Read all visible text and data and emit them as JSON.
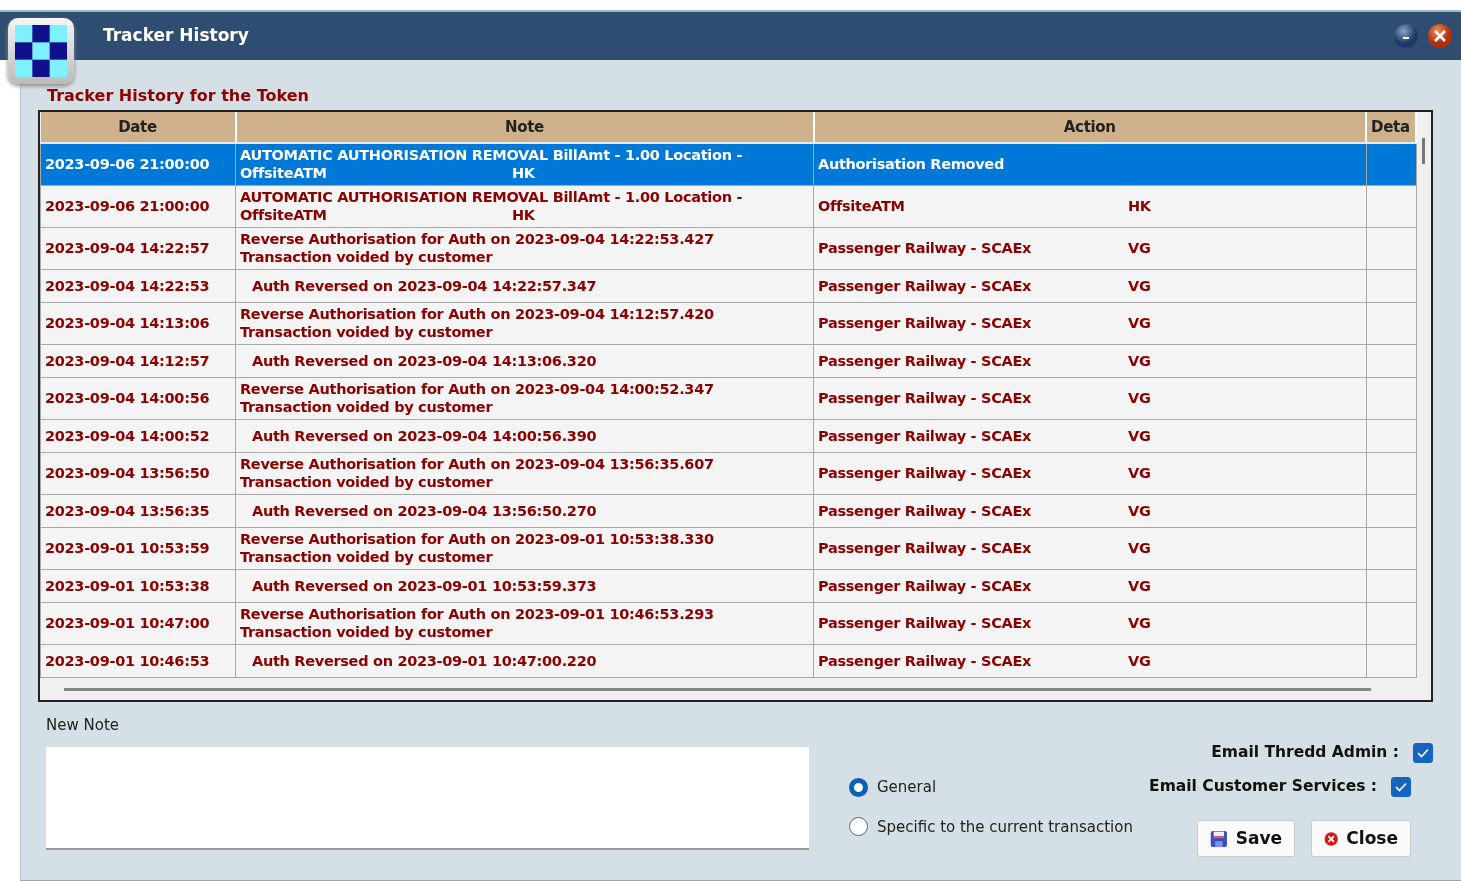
{
  "window": {
    "title": "Tracker History"
  },
  "group_title": "Tracker History for the Token",
  "table": {
    "columns": [
      "Date",
      "Note",
      "Action",
      "Deta"
    ],
    "rows": [
      {
        "date": "2023-09-06 21:00:00",
        "note": [
          [
            "AUTOMATIC AUTHORISATION REMOVAL BillAmt - 1.00 Location -"
          ],
          [
            "OffsiteATM",
            "HK"
          ]
        ],
        "action": [
          "Authorisation Removed"
        ],
        "selected": true
      },
      {
        "date": "2023-09-06 21:00:00",
        "note": [
          [
            "AUTOMATIC AUTHORISATION REMOVAL BillAmt - 1.00 Location -"
          ],
          [
            "OffsiteATM",
            "HK"
          ]
        ],
        "action": [
          "OffsiteATM",
          "HK"
        ],
        "selected": false
      },
      {
        "date": "2023-09-04 14:22:57",
        "note": [
          [
            "Reverse Authorisation for Auth on 2023-09-04 14:22:53.427"
          ],
          [
            "Transaction voided by customer"
          ]
        ],
        "action": [
          "Passenger Railway - SCAEx",
          "VG"
        ],
        "selected": false
      },
      {
        "date": "2023-09-04 14:22:53",
        "note": [
          [
            "Auth Reversed on 2023-09-04 14:22:57.347"
          ]
        ],
        "action": [
          "Passenger Railway - SCAEx",
          "VG"
        ],
        "selected": false
      },
      {
        "date": "2023-09-04 14:13:06",
        "note": [
          [
            "Reverse Authorisation for Auth on 2023-09-04 14:12:57.420"
          ],
          [
            "Transaction voided by customer"
          ]
        ],
        "action": [
          "Passenger Railway - SCAEx",
          "VG"
        ],
        "selected": false
      },
      {
        "date": "2023-09-04 14:12:57",
        "note": [
          [
            "Auth Reversed on 2023-09-04 14:13:06.320"
          ]
        ],
        "action": [
          "Passenger Railway - SCAEx",
          "VG"
        ],
        "selected": false
      },
      {
        "date": "2023-09-04 14:00:56",
        "note": [
          [
            "Reverse Authorisation for Auth on 2023-09-04 14:00:52.347"
          ],
          [
            "Transaction voided by customer"
          ]
        ],
        "action": [
          "Passenger Railway - SCAEx",
          "VG"
        ],
        "selected": false
      },
      {
        "date": "2023-09-04 14:00:52",
        "note": [
          [
            "Auth Reversed on 2023-09-04 14:00:56.390"
          ]
        ],
        "action": [
          "Passenger Railway - SCAEx",
          "VG"
        ],
        "selected": false
      },
      {
        "date": "2023-09-04 13:56:50",
        "note": [
          [
            "Reverse Authorisation for Auth on 2023-09-04 13:56:35.607"
          ],
          [
            "Transaction voided by customer"
          ]
        ],
        "action": [
          "Passenger Railway - SCAEx",
          "VG"
        ],
        "selected": false
      },
      {
        "date": "2023-09-04 13:56:35",
        "note": [
          [
            "Auth Reversed on 2023-09-04 13:56:50.270"
          ]
        ],
        "action": [
          "Passenger Railway - SCAEx",
          "VG"
        ],
        "selected": false
      },
      {
        "date": "2023-09-01 10:53:59",
        "note": [
          [
            "Reverse Authorisation for Auth on 2023-09-01 10:53:38.330"
          ],
          [
            "Transaction voided by customer"
          ]
        ],
        "action": [
          "Passenger Railway - SCAEx",
          "VG"
        ],
        "selected": false
      },
      {
        "date": "2023-09-01 10:53:38",
        "note": [
          [
            "Auth Reversed on 2023-09-01 10:53:59.373"
          ]
        ],
        "action": [
          "Passenger Railway - SCAEx",
          "VG"
        ],
        "selected": false
      },
      {
        "date": "2023-09-01 10:47:00",
        "note": [
          [
            "Reverse Authorisation for Auth on 2023-09-01 10:46:53.293"
          ],
          [
            "Transaction voided by customer"
          ]
        ],
        "action": [
          "Passenger Railway - SCAEx",
          "VG"
        ],
        "selected": false
      },
      {
        "date": "2023-09-01 10:46:53",
        "note": [
          [
            "Auth Reversed on 2023-09-01 10:47:00.220"
          ]
        ],
        "action": [
          "Passenger Railway - SCAEx",
          "VG"
        ],
        "selected": false
      }
    ]
  },
  "new_note": {
    "label": "New Note"
  },
  "note_scope": [
    {
      "label": "General",
      "selected": true
    },
    {
      "label": "Specific to the current transaction",
      "selected": false
    }
  ],
  "email_options": [
    {
      "label": "Email Thredd Admin :",
      "checked": true
    },
    {
      "label": "Email Customer Services :",
      "checked": true
    }
  ],
  "buttons": [
    {
      "label": "Save",
      "kind": "save"
    },
    {
      "label": "Close",
      "kind": "close"
    }
  ]
}
